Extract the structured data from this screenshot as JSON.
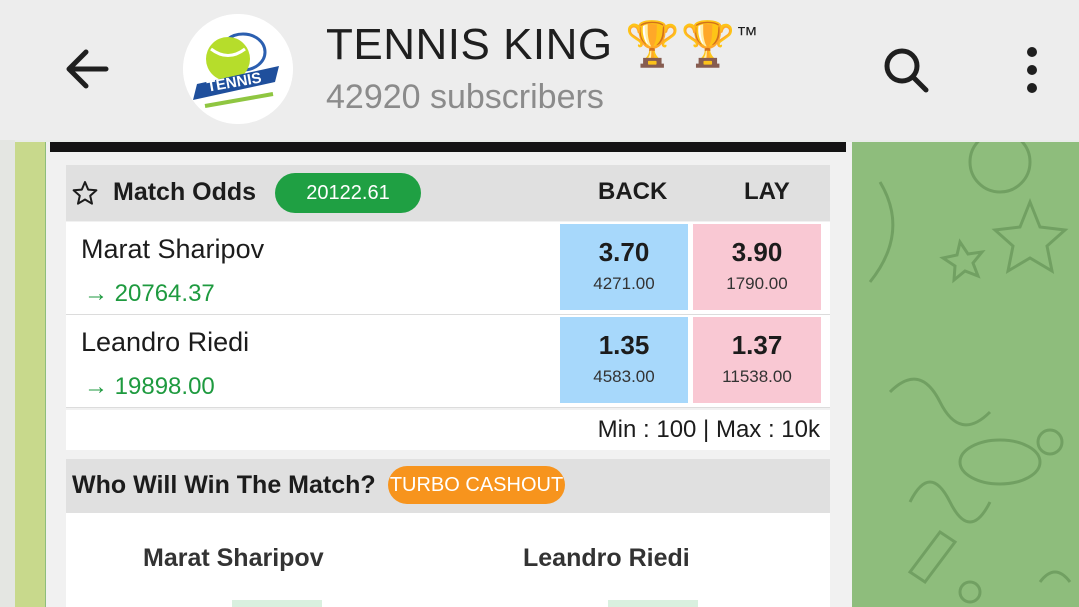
{
  "header": {
    "title": "TENNIS KING",
    "title_emoji": "🏆🏆",
    "title_tm": "™",
    "subscribers": "42920 subscribers",
    "avatar_text": "TENNIS"
  },
  "market": {
    "title": "Match Odds",
    "badge": "20122.61",
    "back_label": "BACK",
    "lay_label": "LAY",
    "runners": [
      {
        "name": "Marat Sharipov",
        "pl": "→ 20764.37",
        "back_odd": "3.70",
        "back_vol": "4271.00",
        "lay_odd": "3.90",
        "lay_vol": "1790.00"
      },
      {
        "name": "Leandro Riedi",
        "pl": "→ 19898.00",
        "back_odd": "1.35",
        "back_vol": "4583.00",
        "lay_odd": "1.37",
        "lay_vol": "11538.00"
      }
    ],
    "limits": "Min : 100 | Max : 10k"
  },
  "winner": {
    "title": "Who Will Win The Match?",
    "badge": "TURBO CASHOUT",
    "player1": "Marat Sharipov",
    "player2": "Leandro Riedi"
  },
  "colors": {
    "back": "#a7d8fb",
    "lay": "#f9c8d3",
    "green": "#1fa043",
    "orange": "#f7941d",
    "wallpaper": "#8ebd7c"
  }
}
